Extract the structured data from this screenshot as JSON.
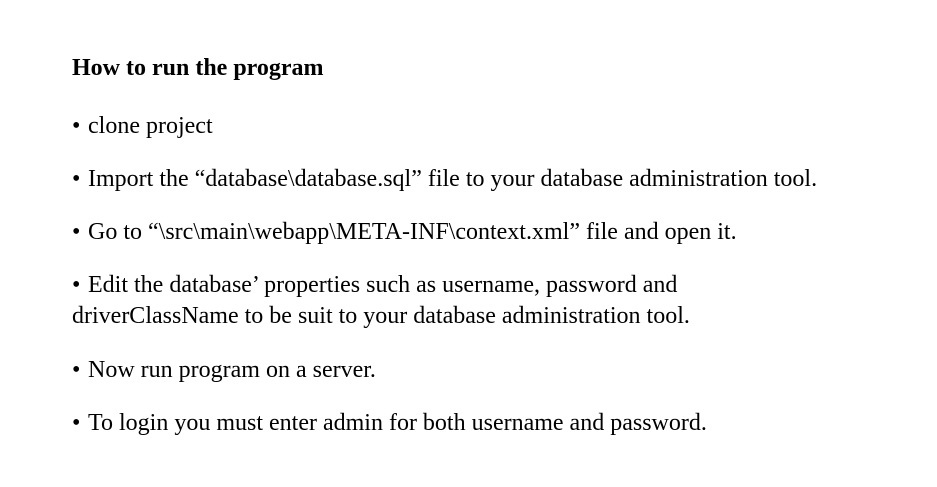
{
  "document": {
    "heading": "How to run the program",
    "bullet_char": "•",
    "items": [
      {
        "text": "clone project"
      },
      {
        "text": "Import the “database\\database.sql” file to your database administration tool."
      },
      {
        "text": "Go to “\\src\\main\\webapp\\META-INF\\context.xml” file and open it."
      },
      {
        "text": "Edit the database’ properties such as username, password and",
        "continuation": "driverClassName to be suit to your database administration tool."
      },
      {
        "text": "Now run program on a server."
      },
      {
        "text": "To login you must enter admin for both username and password."
      }
    ]
  }
}
